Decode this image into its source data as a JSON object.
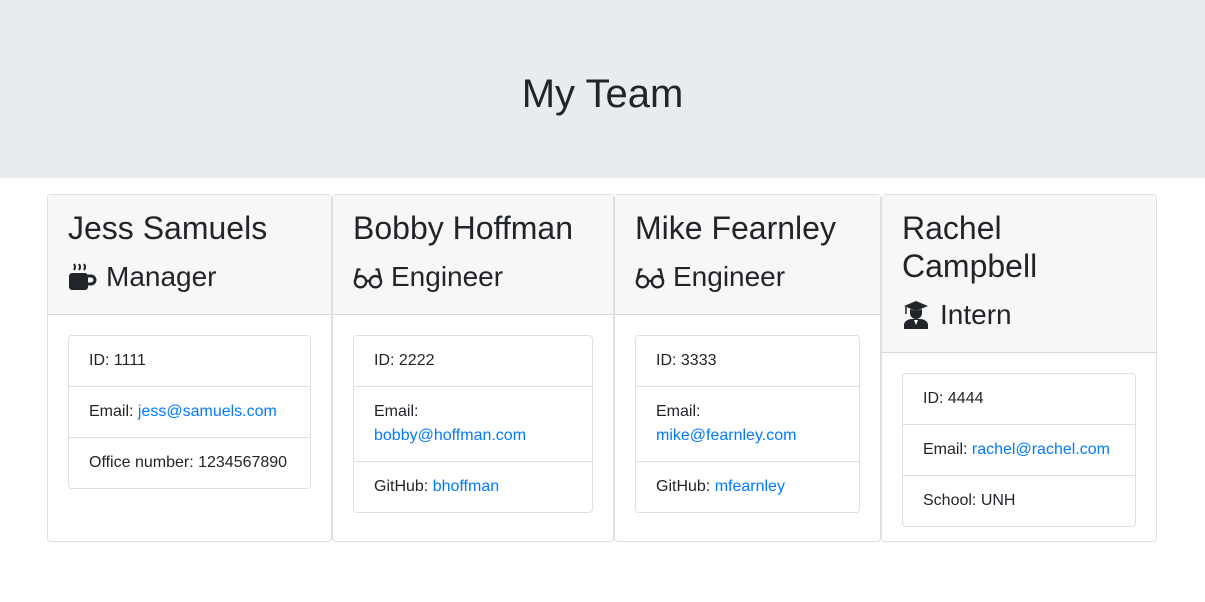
{
  "header": {
    "title": "My Team"
  },
  "employees": [
    {
      "name": "Jess Samuels",
      "role": "Manager",
      "icon": "coffee-icon",
      "id_text": "ID: 1111",
      "email_label": "Email: ",
      "email": "jess@samuels.com",
      "extra_label": "Office number: ",
      "extra_value": "1234567890"
    },
    {
      "name": "Bobby Hoffman",
      "role": "Engineer",
      "icon": "glasses-icon",
      "id_text": "ID: 2222",
      "email_label": "Email: ",
      "email": "bobby@hoffman.com",
      "extra_label": "GitHub: ",
      "extra_value": "bhoffman"
    },
    {
      "name": "Mike Fearnley",
      "role": "Engineer",
      "icon": "glasses-icon",
      "id_text": "ID: 3333",
      "email_label": "Email: ",
      "email": "mike@fearnley.com",
      "extra_label": "GitHub: ",
      "extra_value": "mfearnley"
    },
    {
      "name": "Rachel Campbell",
      "role": "Intern",
      "icon": "graduate-icon",
      "id_text": "ID: 4444",
      "email_label": "Email: ",
      "email": "rachel@rachel.com",
      "extra_label": "School: ",
      "extra_value": "UNH"
    }
  ],
  "colors": {
    "link": "#007bff",
    "header_bg": "#e9ecef",
    "card_header_bg": "#f7f7f7"
  }
}
